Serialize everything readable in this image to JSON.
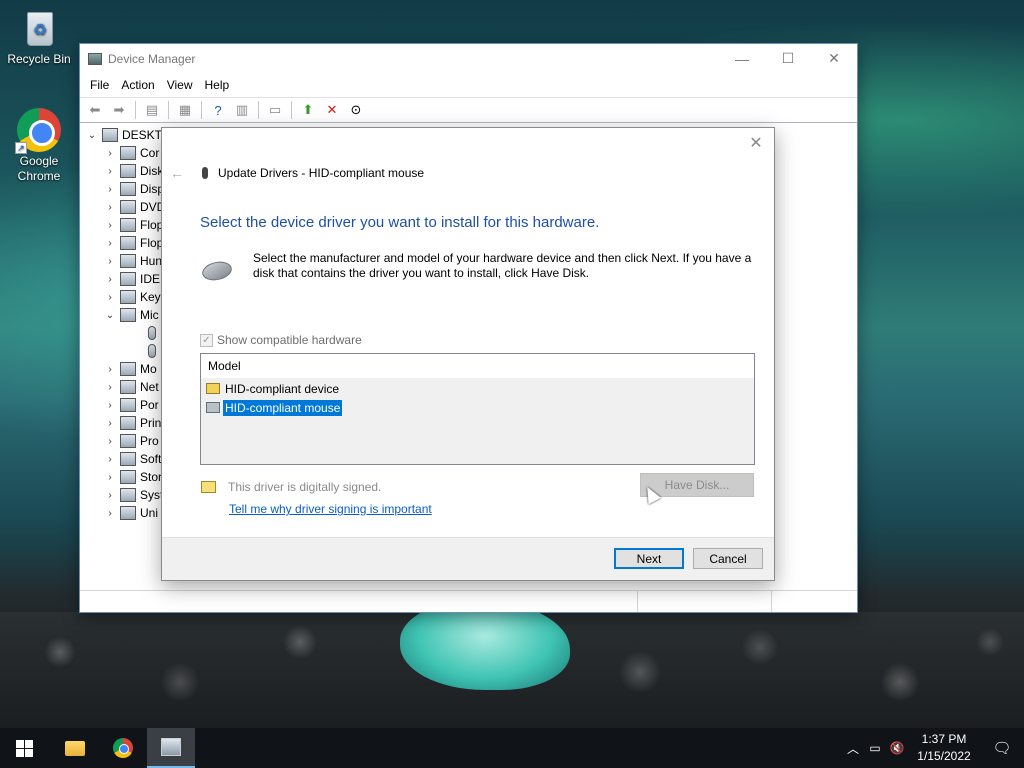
{
  "desktop": {
    "icons": [
      {
        "label": "Recycle Bin",
        "icon": "recycle-bin-icon"
      },
      {
        "label": "Google Chrome",
        "icon": "chrome-icon"
      }
    ]
  },
  "device_manager": {
    "title": "Device Manager",
    "menu": [
      "File",
      "Action",
      "View",
      "Help"
    ],
    "window_controls": {
      "minimize": "—",
      "maximize": "☐",
      "close": "✕"
    },
    "tree": {
      "root": "DESKTO",
      "categories": [
        {
          "label": "Cor",
          "expanded": false
        },
        {
          "label": "Disk",
          "expanded": false
        },
        {
          "label": "Disp",
          "expanded": false
        },
        {
          "label": "DVD",
          "expanded": false
        },
        {
          "label": "Flop",
          "expanded": false
        },
        {
          "label": "Flop",
          "expanded": false
        },
        {
          "label": "Hun",
          "expanded": false
        },
        {
          "label": "IDE",
          "expanded": false
        },
        {
          "label": "Key",
          "expanded": false
        },
        {
          "label": "Mic",
          "expanded": true
        },
        {
          "label": "Mo",
          "expanded": false
        },
        {
          "label": "Net",
          "expanded": false
        },
        {
          "label": "Por",
          "expanded": false
        },
        {
          "label": "Prin",
          "expanded": false
        },
        {
          "label": "Pro",
          "expanded": false
        },
        {
          "label": "Soft",
          "expanded": false
        },
        {
          "label": "Stor",
          "expanded": false
        },
        {
          "label": "Syst",
          "expanded": false
        },
        {
          "label": "Uni",
          "expanded": false
        }
      ]
    }
  },
  "dialog": {
    "title": "Update Drivers - HID-compliant mouse",
    "close": "✕",
    "back": "←",
    "heading": "Select the device driver you want to install for this hardware.",
    "description": "Select the manufacturer and model of your hardware device and then click Next. If you have a disk that contains the driver you want to install, click Have Disk.",
    "show_compatible_label": "Show compatible hardware",
    "show_compatible_checked": true,
    "model_header": "Model",
    "models": [
      {
        "label": "HID-compliant device",
        "selected": false
      },
      {
        "label": "HID-compliant mouse",
        "selected": true
      }
    ],
    "signed_text": "This driver is digitally signed.",
    "signing_link": "Tell me why driver signing is important",
    "have_disk": "Have Disk...",
    "next": "Next",
    "cancel": "Cancel"
  },
  "taskbar": {
    "time": "1:37 PM",
    "date": "1/15/2022"
  },
  "colors": {
    "accent": "#0078d7",
    "heading_blue": "#1e4fa8",
    "link": "#0a5ec2"
  }
}
